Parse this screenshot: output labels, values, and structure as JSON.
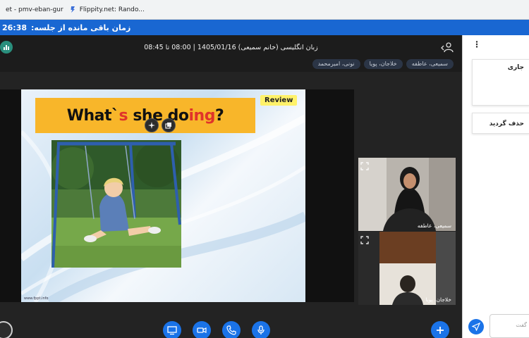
{
  "bookmarks": [
    {
      "label": "et - pmv-eban-gur"
    },
    {
      "label": "Flippity.net: Rando..."
    }
  ],
  "timer": {
    "label": "زمان باقی مانده از جلسه:",
    "value": "26:38"
  },
  "conference": {
    "title": "زبان انگلیسی (خانم سمیعی) 1405/01/16 | 08:00 تا 08:45",
    "participants": [
      {
        "label": "سمیعی، عاطفه"
      },
      {
        "label": "خلاجان، پویا"
      },
      {
        "label": "نونی، امیرمحمد"
      }
    ]
  },
  "slide": {
    "title_pre": "What`",
    "title_s": "s",
    "title_mid": " she do",
    "title_ing": "ing",
    "title_post": "?",
    "badge": "Review",
    "footer": "www.fppt.info"
  },
  "webcams": [
    {
      "name": "سمیعی، عاطفه"
    },
    {
      "name": "خلاجان، پویا"
    }
  ],
  "panel": {
    "card1_text": "جاری",
    "card2_text": "حذف گردید",
    "input_placeholder": "گفت"
  },
  "colors": {
    "accent": "#1a73e8",
    "timer_bar": "#1967d2",
    "slide_title_bg": "#f8b62a",
    "review_badge": "#fff26a"
  },
  "icons": {
    "stats": "stats-icon",
    "user": "user-icon",
    "screen": "screen-share-icon",
    "camera": "camera-icon",
    "phone": "phone-icon",
    "mic": "microphone-icon",
    "plus": "plus-icon",
    "send": "send-icon"
  }
}
